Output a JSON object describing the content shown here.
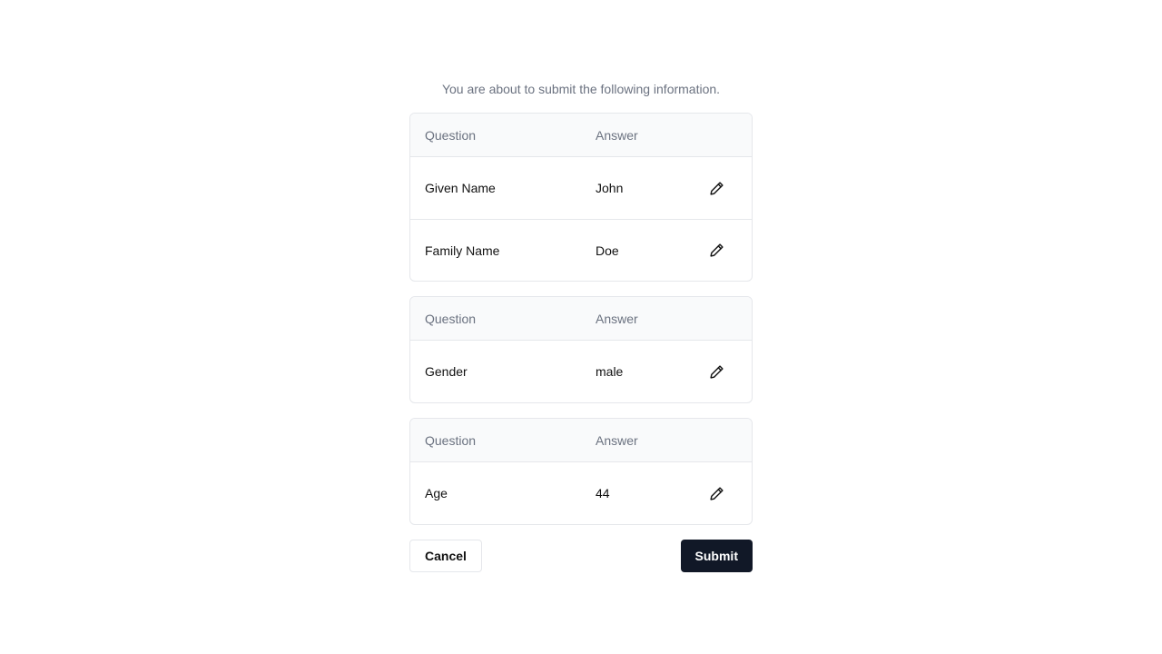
{
  "intro_text": "You are about to submit the following information.",
  "icons": {
    "edit": "pencil-icon"
  },
  "colors": {
    "primary_button": "#111827",
    "muted_text": "#6b7280",
    "border": "#e5e7eb",
    "header_bg": "#f9fafb"
  },
  "cards": [
    {
      "header": {
        "question": "Question",
        "answer": "Answer"
      },
      "rows": [
        {
          "question": "Given Name",
          "answer": "John"
        },
        {
          "question": "Family Name",
          "answer": "Doe"
        }
      ]
    },
    {
      "header": {
        "question": "Question",
        "answer": "Answer"
      },
      "rows": [
        {
          "question": "Gender",
          "answer": "male"
        }
      ]
    },
    {
      "header": {
        "question": "Question",
        "answer": "Answer"
      },
      "rows": [
        {
          "question": "Age",
          "answer": "44"
        }
      ]
    }
  ],
  "actions": {
    "cancel_label": "Cancel",
    "submit_label": "Submit"
  }
}
